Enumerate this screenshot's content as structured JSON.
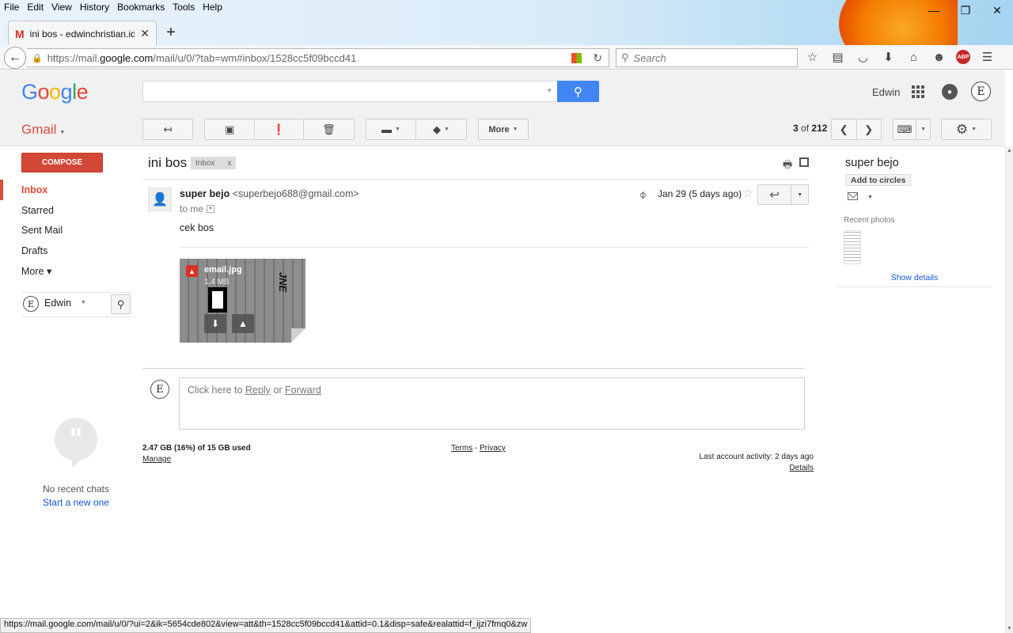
{
  "browser": {
    "menu": [
      "File",
      "Edit",
      "View",
      "History",
      "Bookmarks",
      "Tools",
      "Help"
    ],
    "tab_title": "ini bos - edwinchristian.id...",
    "new_tab": "+",
    "url_prefix": "https://mail.",
    "url_domain": "google.com",
    "url_path": "/mail/u/0/?tab=wm#inbox/1528cc5f09bccd41",
    "search_placeholder": "Search",
    "window_controls": [
      "—",
      "❐",
      "✕"
    ]
  },
  "header": {
    "logo_letters": [
      {
        "ch": "G",
        "color": "#4285f4"
      },
      {
        "ch": "o",
        "color": "#ea4335"
      },
      {
        "ch": "o",
        "color": "#fbbc05"
      },
      {
        "ch": "g",
        "color": "#4285f4"
      },
      {
        "ch": "l",
        "color": "#34a853"
      },
      {
        "ch": "e",
        "color": "#ea4335"
      }
    ],
    "search_value": "",
    "user_name": "Edwin",
    "avatar_letter": "E"
  },
  "toolbar": {
    "gmail_label": "Gmail",
    "more_label": "More",
    "page_current": "3",
    "page_of": "of",
    "page_total": "212"
  },
  "sidebar": {
    "compose_label": "COMPOSE",
    "items": [
      {
        "label": "Inbox",
        "active": true
      },
      {
        "label": "Starred",
        "active": false
      },
      {
        "label": "Sent Mail",
        "active": false
      },
      {
        "label": "Drafts",
        "active": false
      },
      {
        "label": "More ▾",
        "active": false
      }
    ],
    "hangout_user": "Edwin",
    "hangout_avatar": "E",
    "no_chats": "No recent chats",
    "start_new": "Start a new one"
  },
  "message": {
    "subject": "ini bos",
    "label_chip": "Inbox",
    "label_chip_close": "x",
    "sender_name": "super bejo",
    "sender_email": "<superbejo688@gmail.com>",
    "to_me": "to me",
    "date": "Jan 29 (5 days ago)",
    "body": "cek bos",
    "attachment": {
      "filename": "email.jpg",
      "size": "1.4 MB",
      "preview_text": "JNE"
    },
    "reply_prompt": "Click here to",
    "reply_link": "Reply",
    "reply_or": "or",
    "forward_link": "Forward",
    "me_avatar": "E"
  },
  "footer": {
    "storage": "2.47 GB (16%) of 15 GB used",
    "manage": "Manage",
    "terms": "Terms",
    "privacy": "Privacy",
    "terms_sep": "-",
    "activity": "Last account activity: 2 days ago",
    "details": "Details"
  },
  "contact_panel": {
    "name": "super bejo",
    "add_to_circles": "Add to circles",
    "recent_photos": "Recent photos",
    "show_details": "Show details"
  },
  "status_url": "https://mail.google.com/mail/u/0/?ui=2&ik=5654cde802&view=att&th=1528cc5f09bccd41&attid=0.1&disp=safe&realattid=f_ijzi7fmq0&zw",
  "colors": {
    "gmail_red": "#dd4b39",
    "compose_red": "#d14836",
    "search_blue": "#4285f4",
    "link_blue": "#1155cc"
  }
}
